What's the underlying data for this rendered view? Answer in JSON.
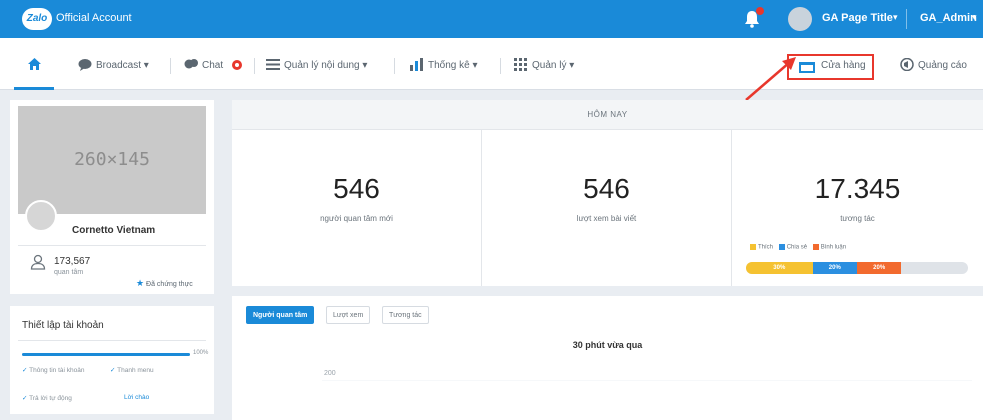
{
  "topbar": {
    "logo_text": "Zalo",
    "app_title": "Official Account",
    "page_title": "GA Page Title",
    "admin_name": "GA_Admin"
  },
  "nav": {
    "items": [
      {
        "label": "Broadcast"
      },
      {
        "label": "Chat"
      },
      {
        "label": "Quản lý nội dung"
      },
      {
        "label": "Thống kê"
      },
      {
        "label": "Quản lý"
      }
    ],
    "store_label": "Cửa hàng",
    "ads_label": "Quảng cáo"
  },
  "profile": {
    "cover_placeholder": "260×145",
    "name": "Cornetto Vietnam",
    "followers": "173,567",
    "followers_label": "quan tâm",
    "verified_label": "Đã chứng thực"
  },
  "setup": {
    "title": "Thiết lập tài khoản",
    "progress_percent": 100,
    "progress_label": "100%",
    "items": [
      "Thông tin tài khoản",
      "Thanh menu",
      "Trả lời tự động"
    ],
    "intro_link": "Lời chào"
  },
  "stats": {
    "header": "HÔM NAY",
    "cards": [
      {
        "value": "546",
        "label": "người quan tâm mới"
      },
      {
        "value": "546",
        "label": "lượt xem bài viết"
      },
      {
        "value": "17.345",
        "label": "tương tác"
      }
    ],
    "legend": [
      {
        "label": "Thích",
        "color": "#f5c231"
      },
      {
        "label": "Chia sẻ",
        "color": "#2b8fe0"
      },
      {
        "label": "Bình luận",
        "color": "#f26a2e"
      }
    ],
    "breakdown": [
      {
        "label": "30%",
        "percent": 30,
        "color": "#f5c231"
      },
      {
        "label": "20%",
        "percent": 20,
        "color": "#2b8fe0"
      },
      {
        "label": "20%",
        "percent": 20,
        "color": "#f26a2e"
      }
    ]
  },
  "chart": {
    "tabs": [
      "Người quan tâm",
      "Lượt xem",
      "Tương tác"
    ],
    "title": "30 phút vừa qua",
    "y_tick": "200"
  },
  "colors": {
    "accent": "#1a8ad8",
    "highlight": "#e8372c"
  }
}
